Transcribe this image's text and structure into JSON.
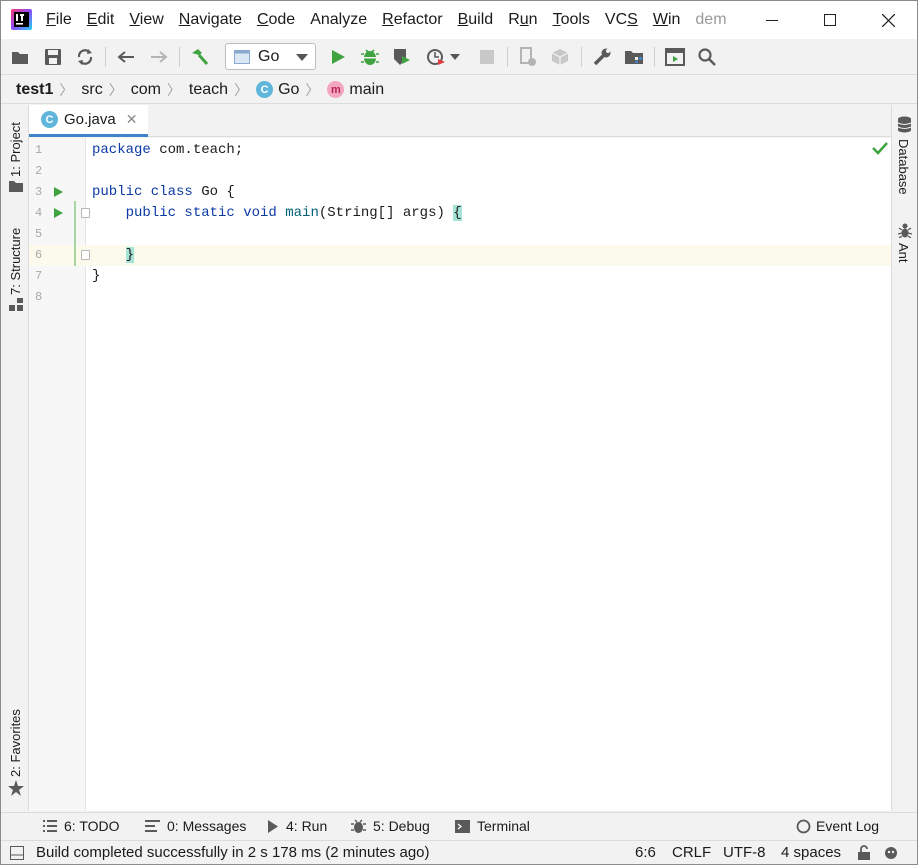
{
  "menu": {
    "items": [
      {
        "label": "File",
        "mnemonic": "F"
      },
      {
        "label": "Edit",
        "mnemonic": "E"
      },
      {
        "label": "View",
        "mnemonic": "V"
      },
      {
        "label": "Navigate",
        "mnemonic": "N"
      },
      {
        "label": "Code",
        "mnemonic": "C"
      },
      {
        "label": "Analyze",
        "mnemonic": ""
      },
      {
        "label": "Refactor",
        "mnemonic": "R"
      },
      {
        "label": "Build",
        "mnemonic": "B"
      },
      {
        "label": "Run",
        "mnemonic": "u"
      },
      {
        "label": "Tools",
        "mnemonic": "T"
      },
      {
        "label": "VCS",
        "mnemonic": "S"
      },
      {
        "label": "Win",
        "mnemonic": "W"
      },
      {
        "label": "dem",
        "mnemonic": ""
      }
    ]
  },
  "toolbar": {
    "run_config": "Go",
    "icons": [
      "open-folder-icon",
      "save-icon",
      "sync-icon",
      "back-arrow-icon",
      "forward-arrow-icon",
      "build-hammer-icon",
      "run-icon",
      "debug-icon",
      "coverage-icon",
      "profile-icon",
      "stop-icon",
      "attach-icon",
      "deploy-icon",
      "settings-wrench-icon",
      "project-structure-icon",
      "presentation-icon",
      "search-icon"
    ]
  },
  "breadcrumb": {
    "project": "test1",
    "folders": [
      "src",
      "com",
      "teach"
    ],
    "class": "Go",
    "method": "main"
  },
  "left_strip": {
    "project": "1: Project",
    "structure": "7: Structure",
    "favorites": "2: Favorites"
  },
  "right_strip": {
    "database": "Database",
    "ant": "Ant"
  },
  "editor": {
    "tab_label": "Go.java",
    "line_numbers": [
      "1",
      "2",
      "3",
      "4",
      "5",
      "6",
      "7",
      "8"
    ],
    "code": {
      "l1_kw": "package",
      "l1_rest": " com.teach;",
      "l3_kw": "public class",
      "l3_rest": " Go {",
      "l4_kw": "public static void",
      "l4_fn": "main",
      "l4_args": "(String[] args) ",
      "l4_brace": "{",
      "l6_brace": "}",
      "l7": "}"
    }
  },
  "bottom_tools": {
    "todo": "6: TODO",
    "messages": "0: Messages",
    "run": "4: Run",
    "debug": "5: Debug",
    "terminal": "Terminal",
    "event_log": "Event Log"
  },
  "status": {
    "message": "Build completed successfully in 2 s 178 ms (2 minutes ago)",
    "position": "6:6",
    "line_separator": "CRLF",
    "encoding": "UTF-8",
    "indent": "4 spaces"
  },
  "colors": {
    "run_green": "#3fa33f",
    "keyword": "#0b3aa5",
    "method": "#00627a",
    "tab_accent": "#4083c9",
    "brace_highlight": "#a6e3d7"
  }
}
